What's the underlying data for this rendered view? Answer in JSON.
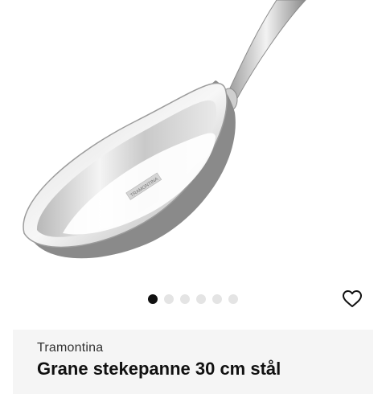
{
  "product": {
    "images": {
      "count": 6,
      "active_index": 0
    },
    "pan_engraving": "TRAMONTINA",
    "favorite_icon": "heart-outline-icon",
    "brand": "Tramontina",
    "title": "Grane stekepanne 30 cm stål"
  },
  "colors": {
    "active_dot": "#111111",
    "inactive_dot": "#e4e4e4",
    "card_background": "#f5f5f5",
    "text_primary": "#111111"
  }
}
